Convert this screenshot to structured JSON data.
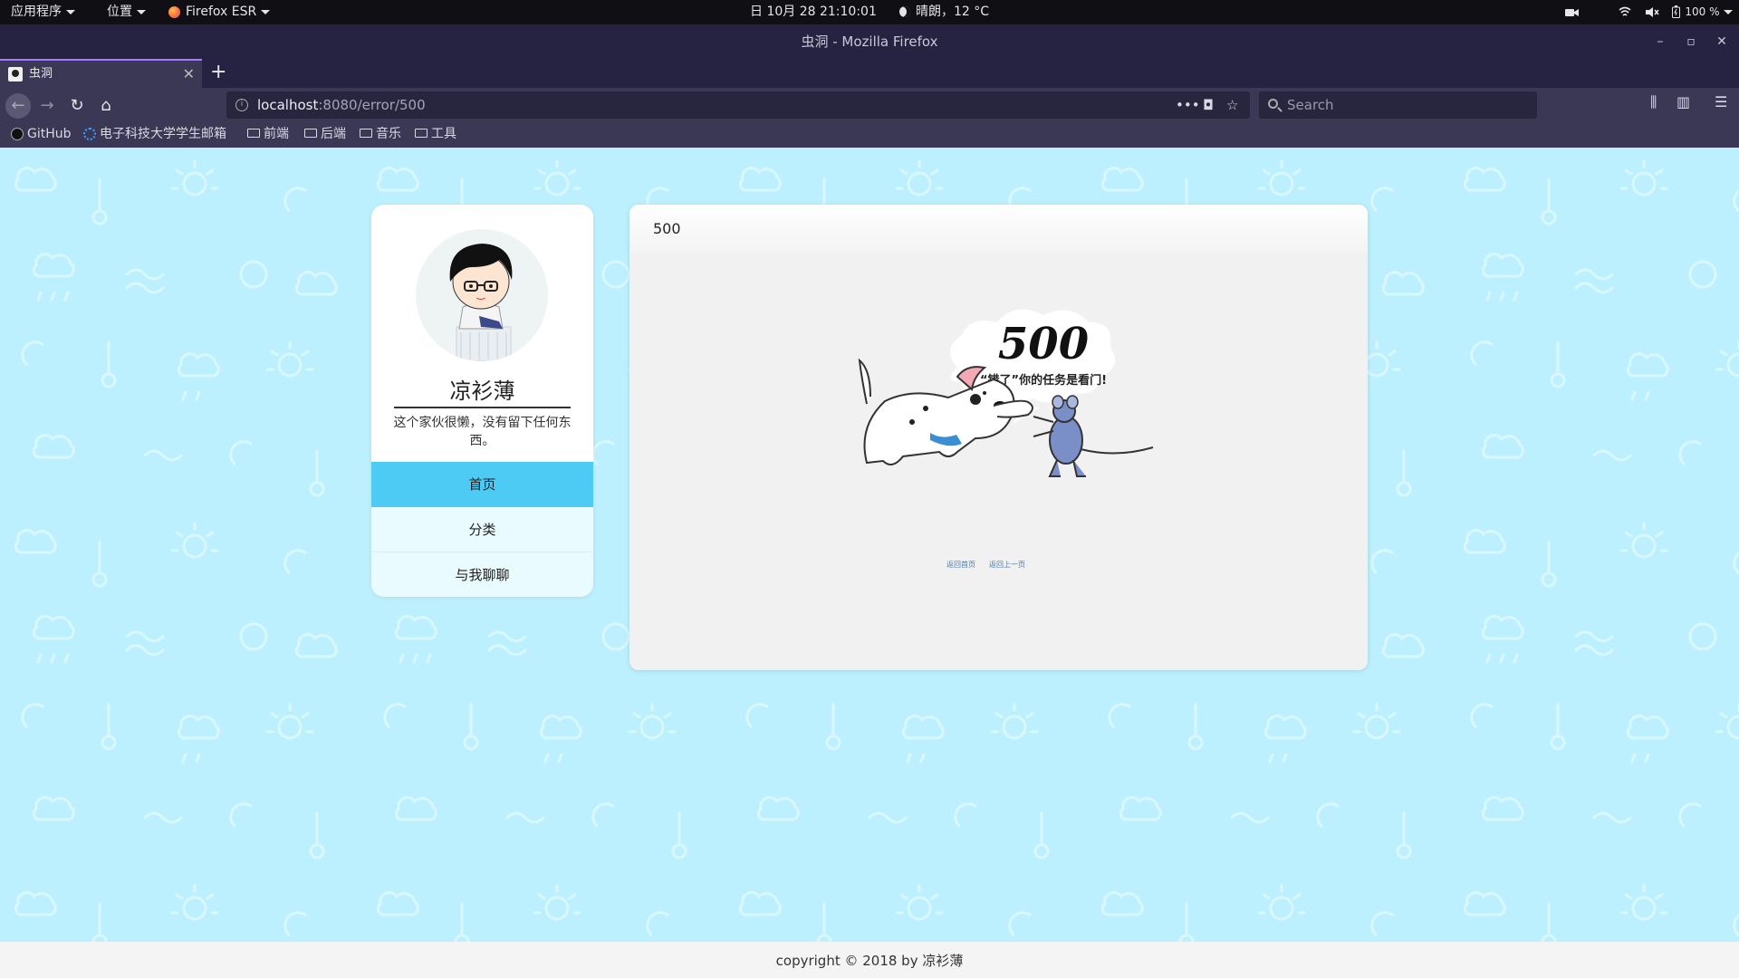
{
  "system_bar": {
    "apps_label": "应用程序",
    "places_label": "位置",
    "firefox_label": "Firefox ESR",
    "datetime": "日 10月 28  21:10:01",
    "weather": "晴朗，12 °C",
    "battery": "100 %"
  },
  "window": {
    "title": "虫洞 - Mozilla Firefox"
  },
  "tab": {
    "label": "虫洞"
  },
  "url": {
    "host": "localhost",
    "path": ":8080/error/500"
  },
  "search": {
    "placeholder": "Search"
  },
  "bookmarks": [
    "GitHub",
    "电子科技大学学生邮箱",
    "前端",
    "后端",
    "音乐",
    "工具"
  ],
  "profile": {
    "name": "凉衫薄",
    "bio": "这个家伙很懒，没有留下任何东西。"
  },
  "nav": {
    "home": "首页",
    "category": "分类",
    "chat": "与我聊聊"
  },
  "error": {
    "header": "500",
    "code_art": "500",
    "caption": "“错了”你的任务是看门!",
    "link_home": "返回首页",
    "link_back": "返回上一页"
  },
  "footer": {
    "copyright": "copyright © 2018 by 凉衫薄"
  },
  "colors": {
    "page_bg": "#bdf0fe",
    "nav_active": "#4ecbf5",
    "browser_chrome": "#3a3855"
  }
}
